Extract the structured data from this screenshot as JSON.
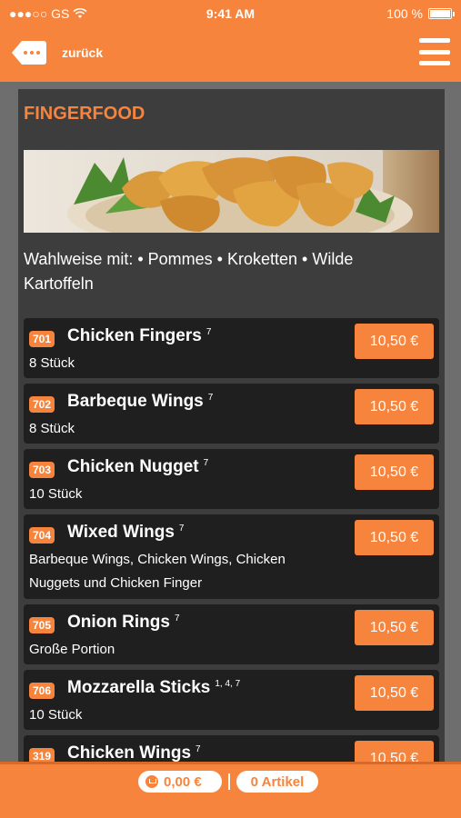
{
  "status_bar": {
    "carrier": "●●●○○ GS",
    "time": "9:41 AM",
    "battery": "100 %",
    "battery_level": 1.0
  },
  "nav": {
    "back_label": "zurück",
    "back_icon": "back-arrow-tag-icon",
    "menu_icon": "hamburger-menu-icon"
  },
  "section": {
    "title": "FINGERFOOD",
    "banner_image": "chicken-nuggets-photo",
    "description": "Wahlweise mit: • Pommes • Kroketten • Wilde Kartoffeln"
  },
  "items": [
    {
      "number": "701",
      "name": "Chicken Fingers",
      "notes": "7",
      "description": "8 Stück",
      "price": "10,50 €"
    },
    {
      "number": "702",
      "name": "Barbeque Wings",
      "notes": "7",
      "description": "8 Stück",
      "price": "10,50 €"
    },
    {
      "number": "703",
      "name": "Chicken Nugget",
      "notes": "7",
      "description": "10 Stück",
      "price": "10,50 €"
    },
    {
      "number": "704",
      "name": "Wixed Wings",
      "notes": "7",
      "description": "Barbeque Wings, Chicken Wings, Chicken Nuggets und Chicken Finger",
      "price": "10,50 €"
    },
    {
      "number": "705",
      "name": "Onion Rings",
      "notes": "7",
      "description": "Große Portion",
      "price": "10,50 €"
    },
    {
      "number": "706",
      "name": "Mozzarella Sticks",
      "notes": "1, 4, 7",
      "description": "10 Stück",
      "price": "10,50 €"
    },
    {
      "number": "319",
      "name": "Chicken Wings",
      "notes": "7",
      "description": "",
      "price": "10,50 €"
    }
  ],
  "bottom_bar": {
    "cart_total": "0,00 €",
    "articles": "0 Artikel",
    "cart_icon": "cart-icon"
  },
  "colors": {
    "accent": "#f7843d",
    "panel": "#3d3d3d",
    "item_bg": "#1f1f1f",
    "page_bg": "#6e6e6e"
  }
}
